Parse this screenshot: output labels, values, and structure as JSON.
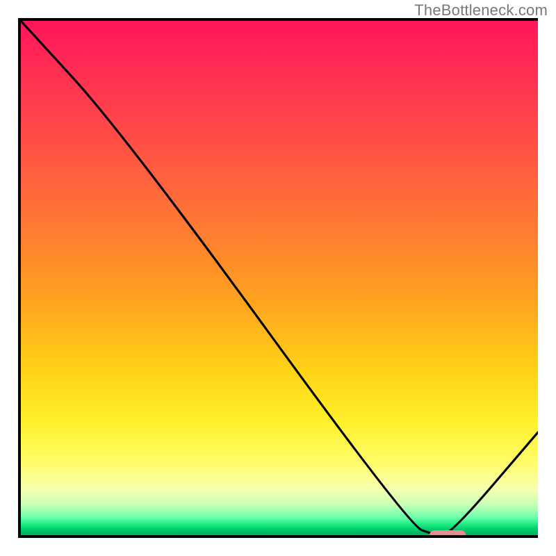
{
  "watermark": "TheBottleneck.com",
  "chart_data": {
    "type": "line",
    "title": "",
    "xlabel": "",
    "ylabel": "",
    "xlim": [
      0,
      100
    ],
    "ylim": [
      0,
      100
    ],
    "grid": false,
    "series": [
      {
        "name": "bottleneck-curve",
        "x": [
          0,
          20,
          75,
          80,
          83,
          100
        ],
        "y": [
          100,
          78,
          2,
          0,
          0,
          20
        ]
      }
    ],
    "marker": {
      "name": "optimal-range",
      "x_start": 79,
      "x_end": 86,
      "y": 0.6,
      "color": "#e98b8f"
    },
    "gradient_stops": [
      {
        "pos": 0.0,
        "color": "#ff1558"
      },
      {
        "pos": 0.4,
        "color": "#ff7a33"
      },
      {
        "pos": 0.78,
        "color": "#fff12a"
      },
      {
        "pos": 1.0,
        "color": "#00b060"
      }
    ]
  },
  "frame": {
    "inner_w": 744,
    "inner_h": 744
  }
}
